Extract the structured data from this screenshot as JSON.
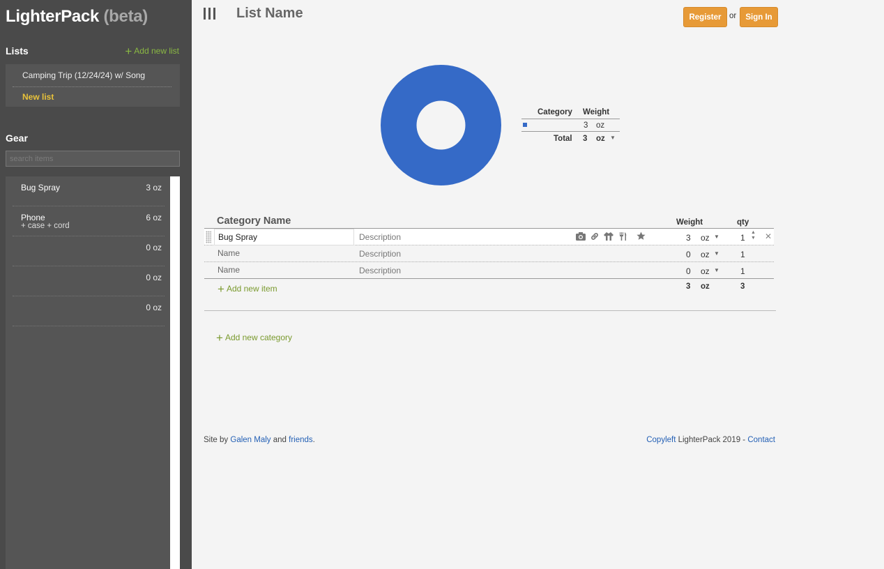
{
  "brand": {
    "name": "LighterPack",
    "beta": "(beta)"
  },
  "sidebar": {
    "lists_heading": "Lists",
    "add_list_label": "Add new list",
    "lists": [
      "Camping Trip (12/24/24) w/ Song",
      "New list"
    ],
    "gear_heading": "Gear",
    "search_placeholder": "search items",
    "gear": [
      {
        "name": "Bug Spray",
        "desc": "",
        "weight": "3 oz"
      },
      {
        "name": "Phone",
        "desc": "+ case + cord",
        "weight": "6 oz"
      },
      {
        "name": "",
        "desc": "",
        "weight": "0 oz"
      },
      {
        "name": "",
        "desc": "",
        "weight": "0 oz"
      },
      {
        "name": "",
        "desc": "",
        "weight": "0 oz"
      }
    ]
  },
  "header": {
    "list_name": "List Name",
    "register_label": "Register",
    "or_text": "or",
    "signin_label": "Sign In"
  },
  "chart_data": {
    "type": "pie",
    "categories": [
      ""
    ],
    "values": [
      3
    ],
    "colors": [
      "#356ac7"
    ]
  },
  "summary": {
    "col_category": "Category",
    "col_weight": "Weight",
    "rows": [
      {
        "category": "",
        "weight": "3",
        "unit": "oz"
      }
    ],
    "total_label": "Total",
    "total_weight": "3",
    "total_unit": "oz"
  },
  "category": {
    "name": "Category Name",
    "col_weight": "Weight",
    "col_qty": "qty",
    "items": [
      {
        "name": "Bug Spray",
        "description": "Description",
        "weight": "3",
        "unit": "oz",
        "qty": "1"
      },
      {
        "name": "Name",
        "description": "Description",
        "weight": "0",
        "unit": "oz",
        "qty": "1"
      },
      {
        "name": "Name",
        "description": "Description",
        "weight": "0",
        "unit": "oz",
        "qty": "1"
      }
    ],
    "add_item_label": "Add new item",
    "total_weight": "3",
    "total_unit": "oz",
    "total_qty": "3"
  },
  "add_category_label": "Add new category",
  "footer": {
    "site_by": "Site by",
    "author": "Galen Maly",
    "and": "and",
    "friends": "friends",
    "period": ".",
    "copyleft": "Copyleft",
    "copyright_text": "LighterPack 2019 -",
    "contact": "Contact"
  },
  "icons": [
    "camera-icon",
    "link-icon",
    "worn-icon",
    "consumable-icon",
    "star-icon",
    "close-icon"
  ],
  "colors": {
    "accent_orange": "#e79a37",
    "accent_green": "#8ab843",
    "chart_blue": "#356ac7",
    "sidebar_bg": "#4a4a4a"
  }
}
